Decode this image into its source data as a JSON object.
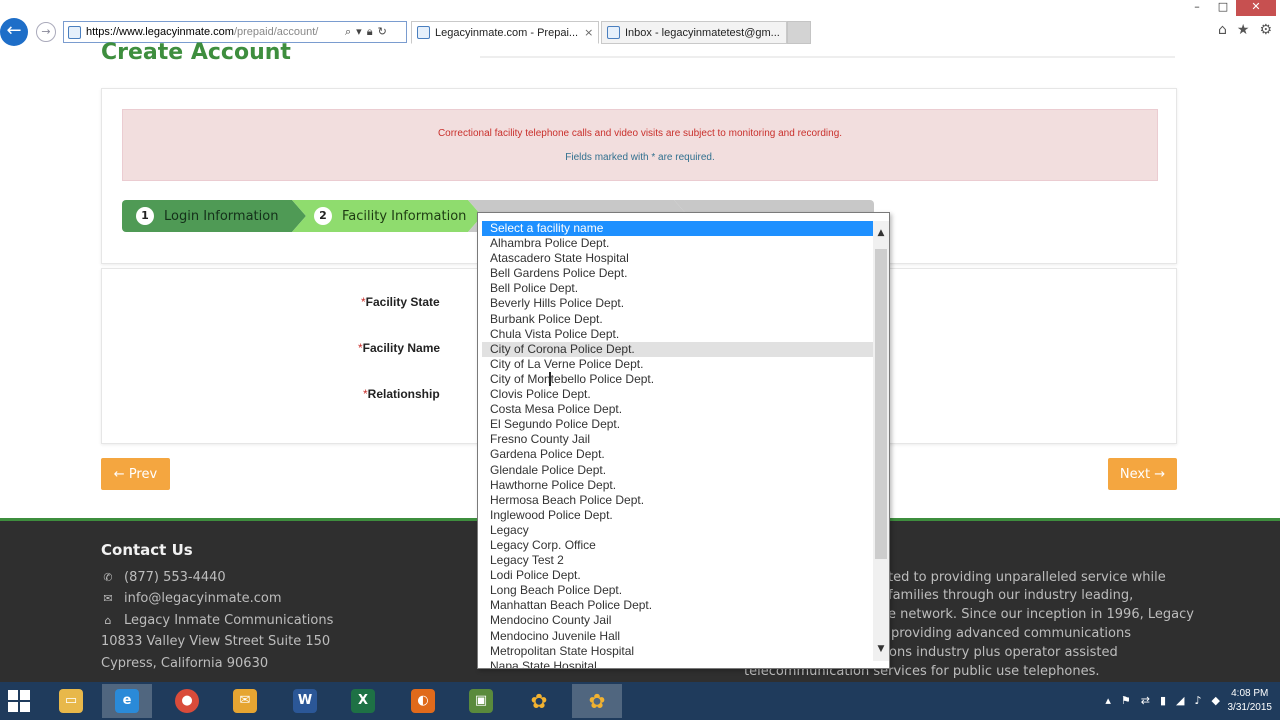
{
  "browser": {
    "url_domain": "https://www.legacyinmate.com",
    "url_path": "/prepaid/account/",
    "tabs": [
      {
        "label": "Legacyinmate.com - Prepai...",
        "active": true
      },
      {
        "label": "Inbox - legacyinmatetest@gm...",
        "active": false
      }
    ],
    "tab_close": "×"
  },
  "page": {
    "title": "Create Account",
    "alert_monitoring": "Correctional facility telephone calls and video visits are subject to monitoring and recording.",
    "alert_required": "Fields marked with * are required.",
    "steps": [
      {
        "number": "1",
        "label": "Login Information"
      },
      {
        "number": "2",
        "label": "Facility Information"
      }
    ],
    "required_mark": "*",
    "fields": {
      "facility_state": "Facility State",
      "facility_name": "Facility Name",
      "relationship": "Relationship"
    },
    "prev_button": "← Prev",
    "next_button": "Next →"
  },
  "footer": {
    "contact_title": "Contact Us",
    "phone": "(877) 553-4440",
    "email": "info@legacyinmate.com",
    "company": "Legacy Inmate Communications",
    "address_line1": "10833 Valley View Street Suite 150",
    "address_line2": "Cypress, California 90630",
    "about_lines": [
      "ted to providing unparalleled service while",
      "families through our industry leading,",
      "e network. Since our inception in 1996, Legacy",
      "providing advanced communications",
      "ons industry plus operator assisted",
      "telecommunication services for public use telephones."
    ]
  },
  "dropdown": {
    "selected_index": 0,
    "hovered_index": 8,
    "options": [
      "Select a facility name",
      "Alhambra Police Dept.",
      "Atascadero State Hospital",
      "Bell Gardens Police Dept.",
      "Bell Police Dept.",
      "Beverly Hills Police Dept.",
      "Burbank Police Dept.",
      "Chula Vista Police Dept.",
      "City of Corona Police Dept.",
      "City of La Verne Police Dept.",
      "City of Montebello Police Dept.",
      "Clovis Police Dept.",
      "Costa Mesa Police Dept.",
      "El Segundo Police Dept.",
      "Fresno County Jail",
      "Gardena Police Dept.",
      "Glendale Police Dept.",
      "Hawthorne Police Dept.",
      "Hermosa Beach Police Dept.",
      "Inglewood Police Dept.",
      "Legacy",
      "Legacy Corp. Office",
      "Legacy Test 2",
      "Lodi Police Dept.",
      "Long Beach Police Dept.",
      "Manhattan Beach Police Dept.",
      "Mendocino County Jail",
      "Mendocino Juvenile Hall",
      "Metropolitan State Hospital",
      "Napa State Hospital"
    ]
  },
  "taskbar": {
    "time": "4:08 PM",
    "date": "3/31/2015"
  },
  "colors": {
    "brand_green": "#3e8e3e",
    "accent_orange": "#f4a640",
    "selection_blue": "#1e90ff",
    "footer_bg": "#2f2f2f"
  },
  "icons": {
    "back": "back-arrow-icon",
    "search": "search-icon",
    "lock": "lock-icon",
    "refresh": "refresh-icon",
    "home": "home-icon",
    "favorites": "star-icon",
    "settings": "gear-icon",
    "phone": "phone-icon",
    "email": "envelope-icon",
    "company": "home-icon"
  }
}
